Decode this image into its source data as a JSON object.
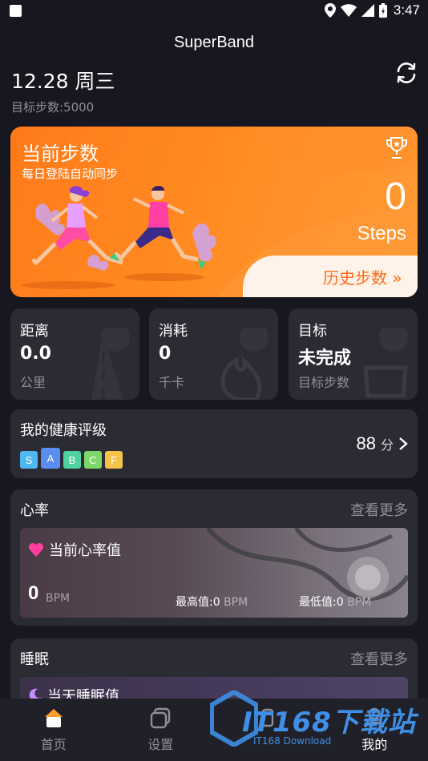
{
  "status_bar": {
    "time": "3:47"
  },
  "app": {
    "title": "SuperBand"
  },
  "header": {
    "date": "12.28 周三",
    "goal_steps": "目标步数:5000"
  },
  "hero": {
    "title": "当前步数",
    "subtitle": "每日登陆自动同步",
    "steps_value": "0",
    "steps_unit": "Steps",
    "history_label": "历史步数 »"
  },
  "stats": [
    {
      "label": "距离",
      "value": "0.0",
      "unit": "公里"
    },
    {
      "label": "消耗",
      "value": "0",
      "unit": "千卡"
    },
    {
      "label": "目标",
      "value": "未完成",
      "unit": "目标步数"
    }
  ],
  "health": {
    "title": "我的健康评级",
    "grades": [
      "S",
      "A",
      "B",
      "C",
      "F"
    ],
    "grade_colors": [
      "#4fb8f0",
      "#5b8cf0",
      "#4fd0a0",
      "#7dd86a",
      "#f5c24a"
    ],
    "score": "88",
    "score_unit": "分"
  },
  "heart": {
    "title": "心率",
    "more": "查看更多",
    "card_title": "当前心率值",
    "value": "0",
    "unit": "BPM",
    "max_label": "最高值:0",
    "min_label": "最低值:0",
    "max_unit": "BPM",
    "min_unit": "BPM"
  },
  "sleep": {
    "title": "睡眠",
    "more": "查看更多",
    "card_title": "当天睡眠值"
  },
  "nav": [
    {
      "label": "首页",
      "icon": "home-icon"
    },
    {
      "label": "设置",
      "icon": "settings-icon"
    },
    {
      "label": "",
      "icon": "watch-icon"
    },
    {
      "label": "我的",
      "icon": "profile-icon"
    }
  ],
  "watermark": {
    "main": "IT168下载站",
    "sub": "IT168 Download"
  },
  "colors": {
    "accent": "#ff7a1a",
    "card": "#2b2b34",
    "background": "#17171f"
  }
}
